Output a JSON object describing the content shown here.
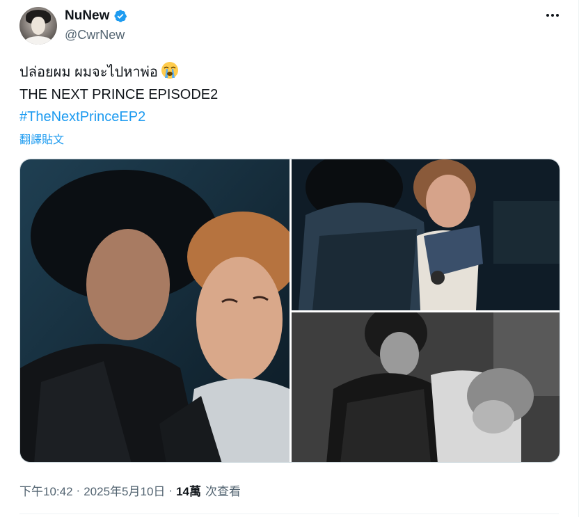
{
  "user": {
    "display_name": "NuNew",
    "handle": "@CwrNew",
    "verified": true
  },
  "tweet": {
    "lines": [
      "ปล่อยผม ผมจะไปหาพ่อ",
      "THE NEXT PRINCE EPISODE2"
    ],
    "emoji": "loudly-crying-face",
    "hashtag": "#TheNextPrinceEP2",
    "translate_label": "翻譯貼文"
  },
  "media": {
    "photos": [
      {
        "desc_icon": "photo-close-up"
      },
      {
        "desc_icon": "photo-embrace-color"
      },
      {
        "desc_icon": "photo-embrace-bw"
      }
    ]
  },
  "meta": {
    "time": "下午10:42",
    "separator": "·",
    "date": "2025年5月10日",
    "views_count": "14萬",
    "views_label": "次查看"
  },
  "colors": {
    "accent": "#1d9bf0",
    "text": "#0f1419",
    "secondary": "#536471"
  }
}
